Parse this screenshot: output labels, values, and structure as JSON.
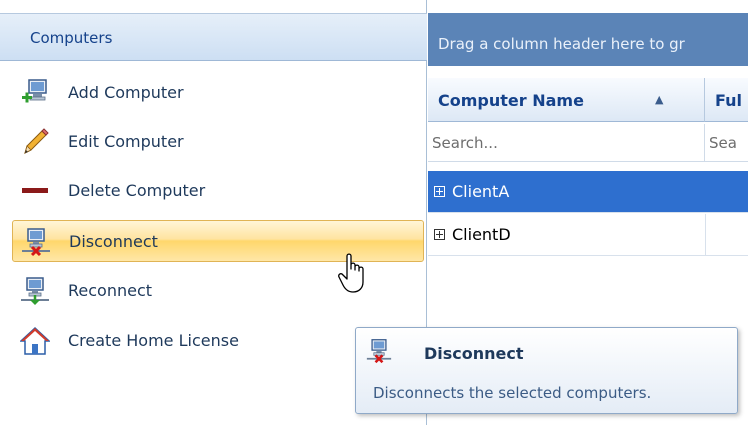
{
  "left_panel": {
    "header": "Computers",
    "items": [
      {
        "label": "Add Computer",
        "icon": "add-computer-icon"
      },
      {
        "label": "Edit Computer",
        "icon": "pencil-icon"
      },
      {
        "label": "Delete Computer",
        "icon": "minus-icon"
      },
      {
        "label": "Disconnect",
        "icon": "disconnect-icon",
        "hovered": true
      },
      {
        "label": "Reconnect",
        "icon": "reconnect-icon"
      },
      {
        "label": "Create Home License",
        "icon": "home-icon"
      }
    ]
  },
  "grid": {
    "group_hint": "Drag a column header here to gr",
    "columns": [
      {
        "label": "Computer Name",
        "sorted": "ascending",
        "sort_glyph": "▲"
      },
      {
        "label": "Ful"
      }
    ],
    "search_placeholders": [
      "Search...",
      "Sea"
    ],
    "rows": [
      {
        "name": "ClientA",
        "selected": true
      },
      {
        "name": "ClientD",
        "selected": false
      }
    ]
  },
  "tooltip": {
    "title": "Disconnect",
    "description": "Disconnects the selected computers.",
    "icon": "disconnect-icon"
  },
  "colors": {
    "accent": "#15428b",
    "selection": "#2e6fcf",
    "group_bar": "#5b84b7",
    "hover_highlight": "#ffd76c"
  }
}
